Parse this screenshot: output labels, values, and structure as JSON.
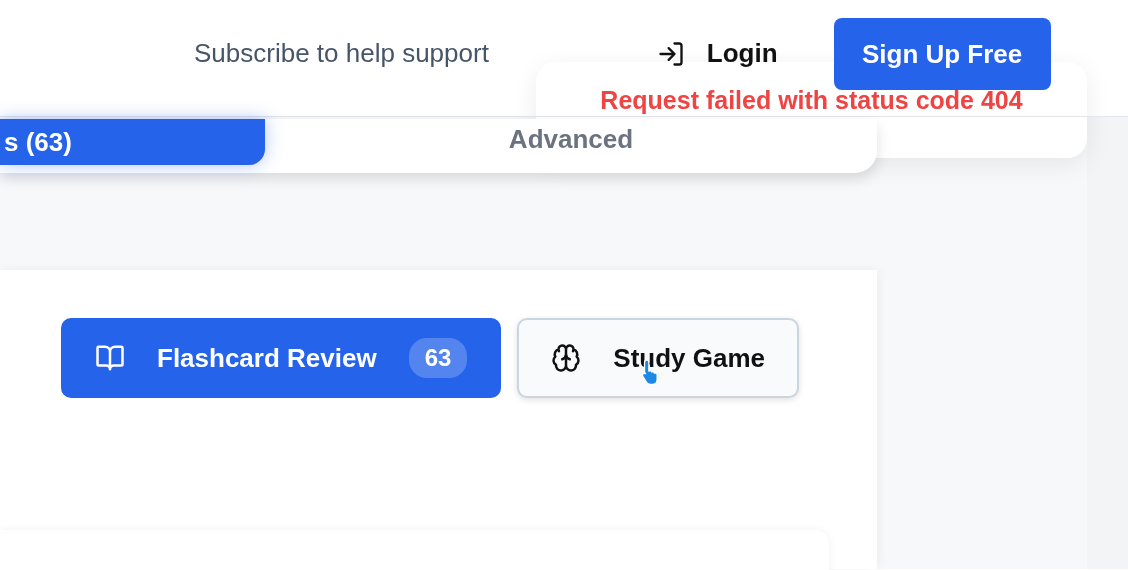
{
  "header": {
    "subscribe_text": "Subscribe to help support",
    "login": "Login",
    "signup": "Sign Up Free"
  },
  "toast": {
    "message": "Request failed with status code 404"
  },
  "tabs": [
    {
      "label": "s (63)",
      "selected": true
    },
    {
      "label": "Advanced",
      "selected": false
    }
  ],
  "actions": [
    {
      "kind": "flashcards",
      "label": "Flashcard Review",
      "count": "63",
      "primary": true
    },
    {
      "kind": "game",
      "label": "Study Game",
      "primary": false
    }
  ]
}
